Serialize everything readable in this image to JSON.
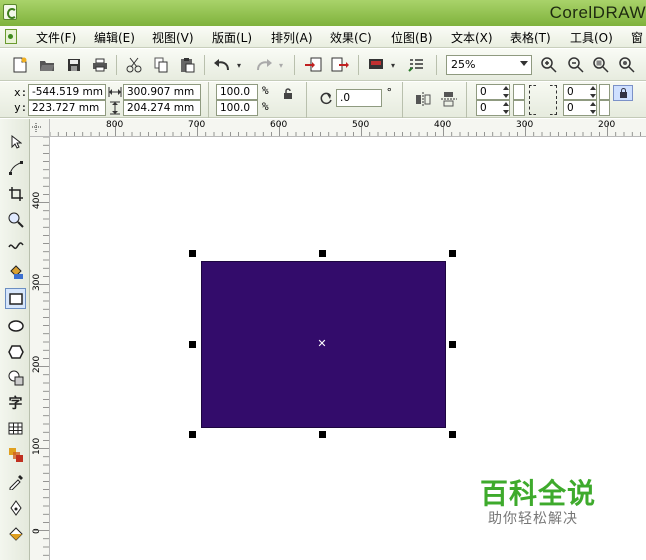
{
  "app": {
    "title": "CorelDRAW"
  },
  "menu": [
    {
      "label": "文件(F)"
    },
    {
      "label": "编辑(E)"
    },
    {
      "label": "视图(V)"
    },
    {
      "label": "版面(L)"
    },
    {
      "label": "排列(A)"
    },
    {
      "label": "效果(C)"
    },
    {
      "label": "位图(B)"
    },
    {
      "label": "文本(X)"
    },
    {
      "label": "表格(T)"
    },
    {
      "label": "工具(O)"
    },
    {
      "label": "窗"
    }
  ],
  "toolbar": {
    "icons": [
      "new-icon",
      "open-icon",
      "save-icon",
      "print-icon",
      "cut-icon",
      "copy-icon",
      "paste-icon",
      "undo-icon",
      "redo-icon",
      "import-icon",
      "export-icon",
      "app-launcher-icon",
      "welcome-icon"
    ],
    "zoom": "25%"
  },
  "properties": {
    "x_label": "x:",
    "y_label": "y:",
    "x": "-544.519 mm",
    "y": "223.727 mm",
    "width": "300.907 mm",
    "height": "204.274 mm",
    "scale_w": "100.0",
    "scale_h": "100.0",
    "percent": "%",
    "rotation": ".0",
    "degree": "°",
    "corner_tl": "0",
    "corner_bl": "0",
    "corner_tr": "0",
    "corner_br": "0"
  },
  "ruler": {
    "horizontal": [
      "800",
      "700",
      "600",
      "500",
      "400",
      "300",
      "200"
    ],
    "vertical": [
      "400",
      "300",
      "200",
      "100",
      "0"
    ]
  },
  "toolbox": [
    "pick-tool-icon",
    "shape-tool-icon",
    "crop-tool-icon",
    "zoom-tool-icon",
    "freehand-tool-icon",
    "smart-fill-icon",
    "rectangle-tool-icon",
    "ellipse-tool-icon",
    "polygon-tool-icon",
    "basic-shapes-icon",
    "text-tool-icon",
    "table-tool-icon",
    "blend-tool-icon",
    "eyedropper-tool-icon",
    "outline-tool-icon",
    "fill-tool-icon"
  ],
  "text_tool_glyph": "字",
  "shape": {
    "fill": "#330c6b"
  },
  "watermark": {
    "title": "百科全说",
    "subtitle": "助你轻松解决"
  }
}
